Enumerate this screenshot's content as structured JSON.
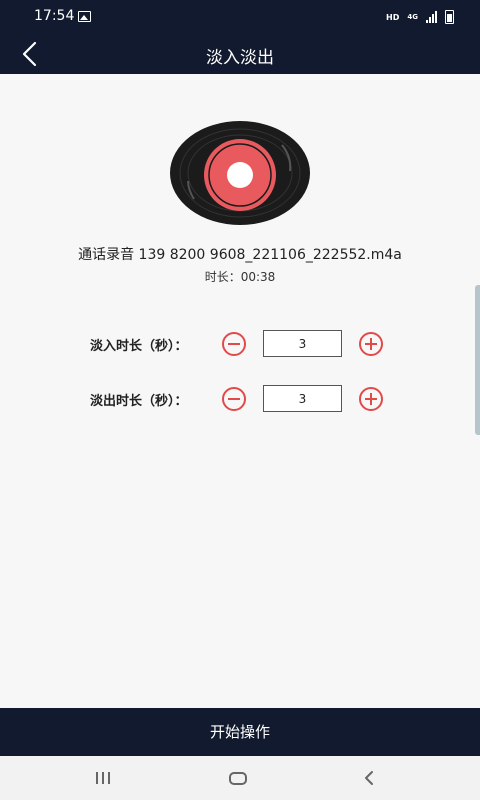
{
  "status_bar": {
    "time": "17:54",
    "hd": "HD",
    "network": "4G"
  },
  "header": {
    "title": "淡入淡出"
  },
  "media": {
    "file_name": "通话录音 139 8200 9608_221106_222552.m4a",
    "duration": "时长：00:38"
  },
  "settings": {
    "fade_in": {
      "label": "淡入时长（秒）：",
      "value": "3"
    },
    "fade_out": {
      "label": "淡出时长（秒）：",
      "value": "3"
    }
  },
  "start_button": {
    "label": "开始操作"
  },
  "colors": {
    "header_bg": "#111a2e",
    "accent_red": "#e24a4a",
    "record_label": "#e85a5e"
  }
}
